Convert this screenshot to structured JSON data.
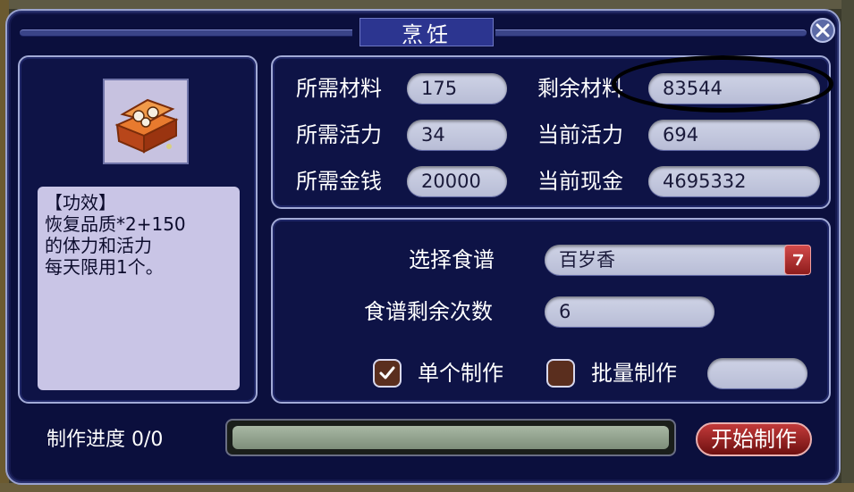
{
  "window": {
    "title": "烹饪"
  },
  "item": {
    "icon": "treasure-chest-icon",
    "effect_lines": [
      "【功效】",
      "恢复品质*2+150",
      "的体力和活力",
      "每天限用1个。"
    ]
  },
  "stats": {
    "required_material": {
      "label": "所需材料",
      "value": "175"
    },
    "remaining_material": {
      "label": "剩余材料",
      "value": "83544"
    },
    "required_energy": {
      "label": "所需活力",
      "value": "34"
    },
    "current_energy": {
      "label": "当前活力",
      "value": "694"
    },
    "required_money": {
      "label": "所需金钱",
      "value": "20000"
    },
    "current_cash": {
      "label": "当前现金",
      "value": "4695332"
    }
  },
  "recipe": {
    "select_label": "选择食谱",
    "selected": "百岁香",
    "remaining_label": "食谱剩余次数",
    "remaining_value": "6"
  },
  "mode": {
    "single_label": "单个制作",
    "single_checked": true,
    "batch_label": "批量制作",
    "batch_checked": false,
    "batch_quantity": ""
  },
  "progress": {
    "label": "制作进度",
    "value": "0/0",
    "fill_fraction": 1.0
  },
  "start_button_label": "开始制作",
  "colors": {
    "window_bg": "#0b0f3d",
    "field_bg": "#c5c9de",
    "accent_red": "#a82424",
    "annotation": "#000000"
  }
}
